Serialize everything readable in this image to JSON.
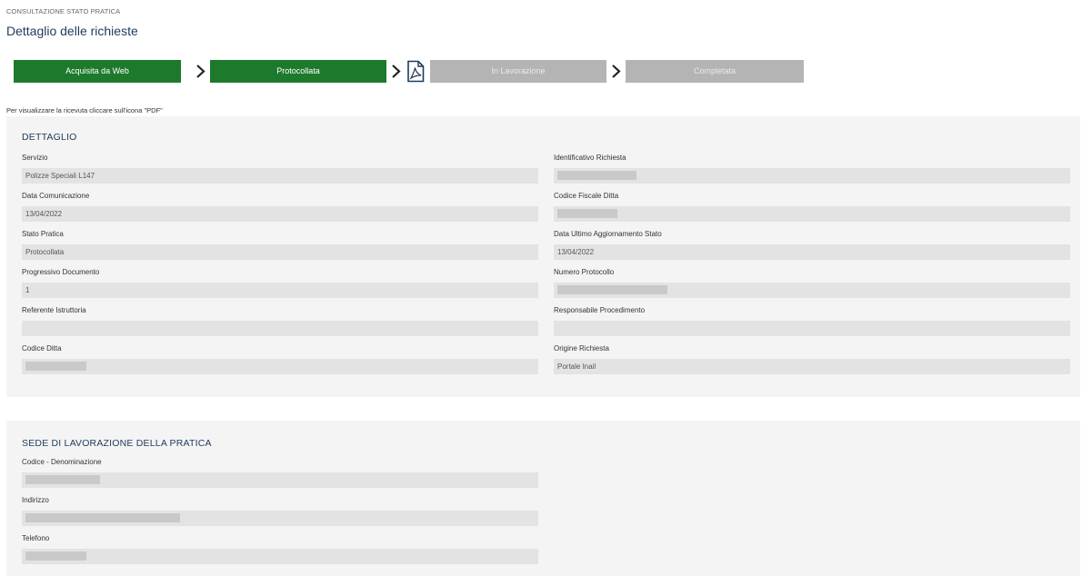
{
  "header": {
    "breadcrumb": "CONSULTAZIONE STATO PRATICA",
    "title": "Dettaglio delle richieste"
  },
  "steps": [
    {
      "label": "Acquisita da Web",
      "state": "done"
    },
    {
      "label": "Protocollata",
      "state": "done"
    },
    {
      "label": "In Lavorazione",
      "state": "pending"
    },
    {
      "label": "Completata",
      "state": "pending"
    }
  ],
  "hint": "Per visualizzare la ricevuta cliccare sull'icona \"PDF\"",
  "colors": {
    "done": "#1d7a2c",
    "pending": "#b4b4b4",
    "title": "#1f3a5a"
  },
  "dettaglio": {
    "title": "DETTAGLIO",
    "servizio": {
      "label": "Servizio",
      "value": "Polizze Speciali L147"
    },
    "identificativo": {
      "label": "Identificativo Richiesta",
      "value": ""
    },
    "data_comunicazione": {
      "label": "Data Comunicazione",
      "value": "13/04/2022"
    },
    "codice_fiscale": {
      "label": "Codice Fiscale Ditta",
      "value": ""
    },
    "stato_pratica": {
      "label": "Stato Pratica",
      "value": "Protocollata"
    },
    "data_ultimo": {
      "label": "Data Ultimo Aggiornamento Stato",
      "value": "13/04/2022"
    },
    "progressivo": {
      "label": "Progressivo Documento",
      "value": "1"
    },
    "numero_protocollo": {
      "label": "Numero Protocollo",
      "value": ""
    },
    "referente": {
      "label": "Referente Istruttoria",
      "value": ""
    },
    "responsabile": {
      "label": "Responsabile Procedimento",
      "value": ""
    },
    "codice_ditta": {
      "label": "Codice Ditta",
      "value": ""
    },
    "origine": {
      "label": "Origine Richiesta",
      "value": "Portale Inail"
    }
  },
  "sede": {
    "title": "SEDE DI LAVORAZIONE DELLA PRATICA",
    "codice": {
      "label": "Codice - Denominazione",
      "value": ""
    },
    "indirizzo": {
      "label": "Indirizzo",
      "value": ""
    },
    "telefono": {
      "label": "Telefono",
      "value": ""
    }
  }
}
